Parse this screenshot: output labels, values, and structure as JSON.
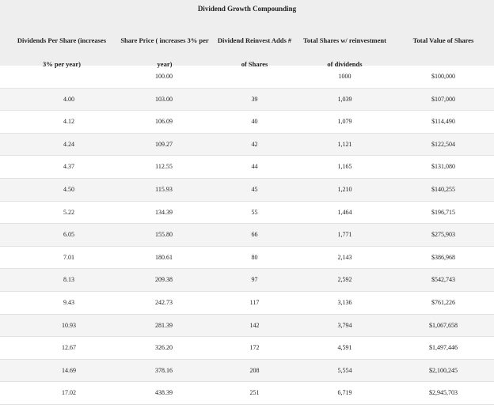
{
  "title": "Dividend Growth Compounding",
  "headers": [
    {
      "line1": "Dividends Per Share (increases",
      "line2": "3% per year)"
    },
    {
      "line1": "Share Price  ( increases 3% per",
      "line2": "year)"
    },
    {
      "line1": "Dividend Reinvest Adds #",
      "line2": "of Shares"
    },
    {
      "line1": "Total Shares w/ reinvestment",
      "line2": "of dividends"
    },
    {
      "line1": "Total Value of Shares",
      "line2": ""
    }
  ],
  "rows": [
    [
      "",
      "100.00",
      "",
      "1000",
      "$100,000"
    ],
    [
      "4.00",
      "103.00",
      "39",
      "1,039",
      "$107,000"
    ],
    [
      "4.12",
      "106.09",
      "40",
      "1,079",
      "$114,490"
    ],
    [
      "4.24",
      "109.27",
      "42",
      "1,121",
      "$122,504"
    ],
    [
      "4.37",
      "112.55",
      "44",
      "1,165",
      "$131,080"
    ],
    [
      "4.50",
      "115.93",
      "45",
      "1,210",
      "$140,255"
    ],
    [
      "5.22",
      "134.39",
      "55",
      "1,464",
      "$196,715"
    ],
    [
      "6.05",
      "155.80",
      "66",
      "1,771",
      "$275,903"
    ],
    [
      "7.01",
      "180.61",
      "80",
      "2,143",
      "$386,968"
    ],
    [
      "8.13",
      "209.38",
      "97",
      "2,592",
      "$542,743"
    ],
    [
      "9.43",
      "242.73",
      "117",
      "3,136",
      "$761,226"
    ],
    [
      "10.93",
      "281.39",
      "142",
      "3,794",
      "$1,067,658"
    ],
    [
      "12.67",
      "326.20",
      "172",
      "4,591",
      "$1,497,446"
    ],
    [
      "14.69",
      "378.16",
      "208",
      "5,554",
      "$2,100,245"
    ],
    [
      "17.02",
      "438.39",
      "251",
      "6,719",
      "$2,945,703"
    ]
  ]
}
